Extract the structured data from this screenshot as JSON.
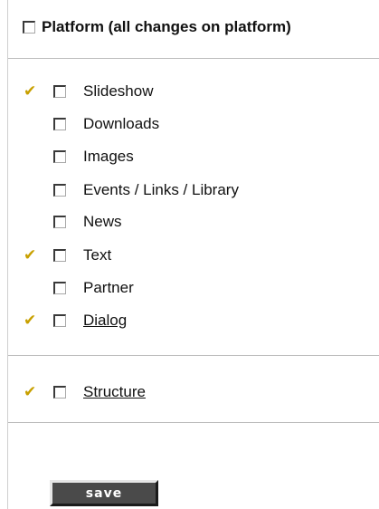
{
  "colors": {
    "check_mark": "#c8a000",
    "button_bg": "#4a4a4a",
    "button_text": "#ffffff",
    "divider": "#bdbdbd"
  },
  "platform": {
    "label": "Platform (all changes on platform)",
    "checked": false
  },
  "check_icon_glyph": "✔",
  "items": [
    {
      "label": "Slideshow",
      "marked": true,
      "checked": false,
      "link": false
    },
    {
      "label": "Downloads",
      "marked": false,
      "checked": false,
      "link": false
    },
    {
      "label": "Images",
      "marked": false,
      "checked": false,
      "link": false
    },
    {
      "label": "Events / Links / Library",
      "marked": false,
      "checked": false,
      "link": false
    },
    {
      "label": "News",
      "marked": false,
      "checked": false,
      "link": false
    },
    {
      "label": "Text",
      "marked": true,
      "checked": false,
      "link": false
    },
    {
      "label": "Partner",
      "marked": false,
      "checked": false,
      "link": false
    },
    {
      "label": "Dialog",
      "marked": true,
      "checked": false,
      "link": true
    }
  ],
  "structure": {
    "label": "Structure",
    "marked": true,
    "checked": false,
    "link": true
  },
  "save_button": {
    "label": "save"
  }
}
